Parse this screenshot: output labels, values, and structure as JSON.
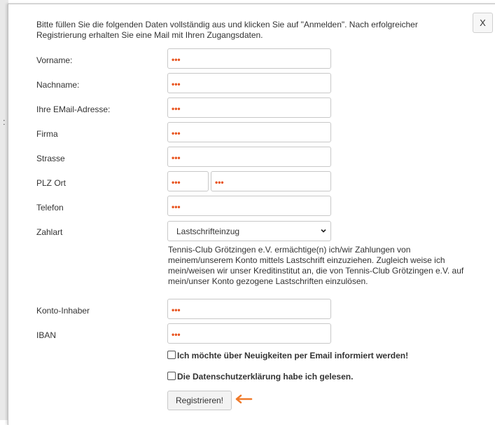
{
  "dialog": {
    "close_label": "X",
    "intro": "Bitte füllen Sie die folgenden Daten vollständig aus und klicken Sie auf \"Anmelden\". Nach erfolgreicher Registrierung erhalten Sie eine Mail mit Ihren Zugangsdaten."
  },
  "form": {
    "required_marker": "•••",
    "fields": {
      "vorname": "Vorname:",
      "nachname": "Nachname:",
      "email": "Ihre EMail-Adresse:",
      "firma": "Firma",
      "strasse": "Strasse",
      "plz_ort": "PLZ Ort",
      "telefon": "Telefon",
      "zahlart": "Zahlart",
      "konto_inhaber": "Konto-Inhaber",
      "iban": "IBAN"
    },
    "zahlart_selected": "Lastschrifteinzug",
    "mandate_text": "Tennis-Club Grötzingen e.V. ermächtige(n) ich/wir Zahlungen von meinem/unserem Konto mittels Lastschrift einzuziehen. Zugleich weise ich mein/weisen wir unser Kreditinstitut an, die von Tennis-Club Grötzingen e.V. auf mein/unser Konto gezogene Lastschriften einzulösen.",
    "newsletter_label": "Ich möchte über Neuigkeiten per Email informiert werden!",
    "privacy_label": "Die Datenschutzerklärung habe ich gelesen.",
    "submit_label": "Registrieren!"
  },
  "colors": {
    "required_marker": "#e8531e",
    "arrow": "#f07a2a"
  },
  "icons": {
    "close": "close-icon",
    "select": "chevron-down-icon",
    "pointer": "arrow-left-icon"
  }
}
